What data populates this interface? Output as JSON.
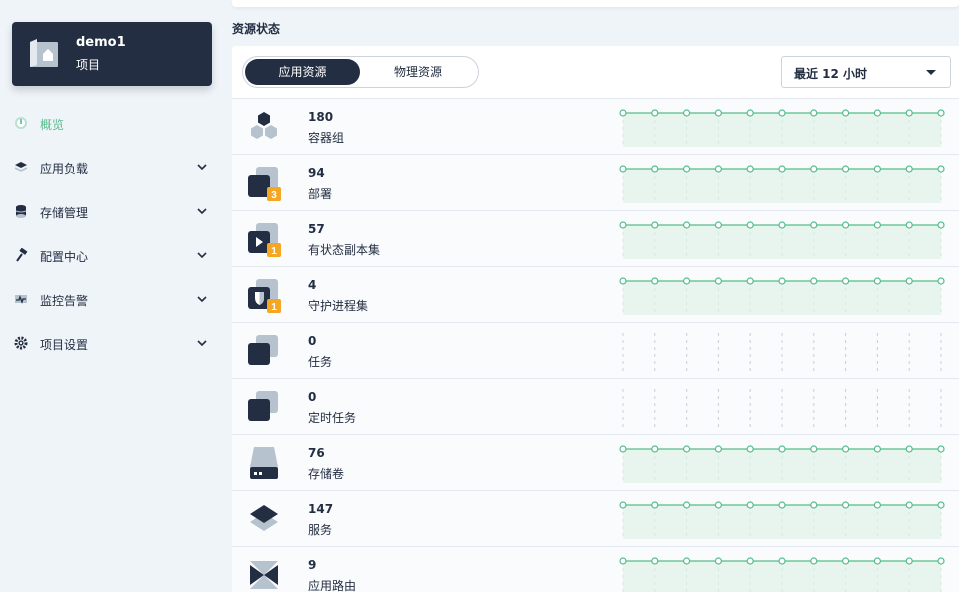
{
  "project": {
    "name": "demo1",
    "type": "项目"
  },
  "nav": [
    {
      "label": "概览",
      "icon": "dashboard-icon",
      "active": true,
      "expandable": false
    },
    {
      "label": "应用负载",
      "icon": "appcenter-icon",
      "active": false,
      "expandable": true
    },
    {
      "label": "存储管理",
      "icon": "storage-icon",
      "active": false,
      "expandable": true
    },
    {
      "label": "配置中心",
      "icon": "hammer-icon",
      "active": false,
      "expandable": true
    },
    {
      "label": "监控告警",
      "icon": "monitor-icon",
      "active": false,
      "expandable": true
    },
    {
      "label": "项目设置",
      "icon": "gear-icon",
      "active": false,
      "expandable": true
    }
  ],
  "section_title": "资源状态",
  "tabs": [
    {
      "label": "应用资源",
      "selected": true
    },
    {
      "label": "物理资源",
      "selected": false
    }
  ],
  "time_select": {
    "value": "最近 12 小时"
  },
  "resources": [
    {
      "count": "180",
      "label": "容器组",
      "icon": "pods-icon",
      "badge": null,
      "trend": [
        180,
        180,
        180,
        180,
        180,
        180,
        180,
        180,
        180,
        180,
        180
      ]
    },
    {
      "count": "94",
      "label": "部署",
      "icon": "deployment-icon",
      "badge": "3",
      "trend": [
        94,
        94,
        94,
        94,
        94,
        94,
        94,
        94,
        94,
        94,
        94
      ]
    },
    {
      "count": "57",
      "label": "有状态副本集",
      "icon": "statefulset-icon",
      "badge": "1",
      "trend": [
        57,
        57,
        57,
        57,
        57,
        57,
        57,
        57,
        57,
        57,
        57
      ]
    },
    {
      "count": "4",
      "label": "守护进程集",
      "icon": "daemonset-icon",
      "badge": "1",
      "trend": [
        4,
        4,
        4,
        4,
        4,
        4,
        4,
        4,
        4,
        4,
        4
      ]
    },
    {
      "count": "0",
      "label": "任务",
      "icon": "job-icon",
      "badge": null,
      "trend": []
    },
    {
      "count": "0",
      "label": "定时任务",
      "icon": "cronjob-icon",
      "badge": null,
      "trend": []
    },
    {
      "count": "76",
      "label": "存储卷",
      "icon": "volume-icon",
      "badge": null,
      "trend": [
        76,
        76,
        76,
        76,
        76,
        76,
        76,
        76,
        76,
        76,
        76
      ]
    },
    {
      "count": "147",
      "label": "服务",
      "icon": "service-icon",
      "badge": null,
      "trend": [
        147,
        147,
        147,
        147,
        147,
        147,
        147,
        147,
        147,
        147,
        147
      ]
    },
    {
      "count": "9",
      "label": "应用路由",
      "icon": "ingress-icon",
      "badge": null,
      "trend": [
        9,
        9,
        9,
        9,
        9,
        9,
        9,
        9,
        9,
        9,
        9
      ]
    }
  ],
  "colors": {
    "accent": "#55bc8a",
    "dark": "#242e42",
    "badge": "#f5a623",
    "iconLight": "#b6c2cd"
  }
}
